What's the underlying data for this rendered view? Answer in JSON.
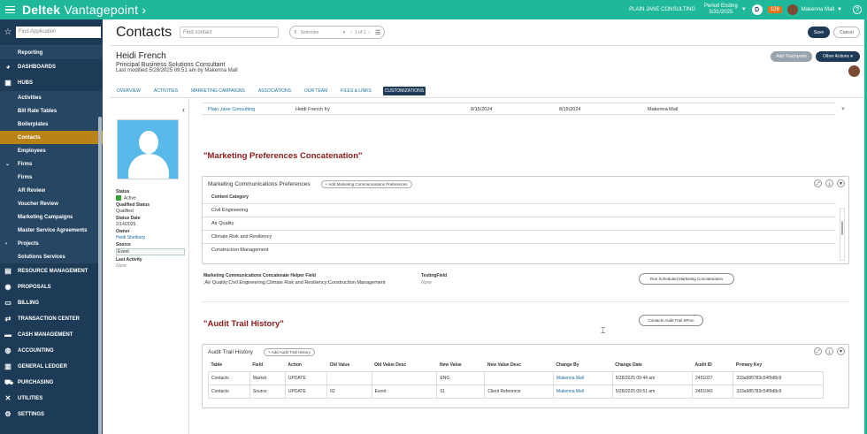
{
  "topbar": {
    "brand_main": "Deltek",
    "brand_sub": "Vantagepoint",
    "company": "PLAIN JANE CONSULTING",
    "period_label": "Period Ending",
    "period_date": "5/31/2025",
    "d_letter": "D",
    "notif_count": "128",
    "user": "Makenna Mall",
    "help": "?"
  },
  "sidebar": {
    "find_placeholder": "Find Application",
    "items": [
      {
        "label": "Reporting"
      },
      {
        "label": "DASHBOARDS"
      },
      {
        "label": "HUBS"
      },
      {
        "label": "Activities"
      },
      {
        "label": "Bill Rate Tables"
      },
      {
        "label": "Boilerplates"
      },
      {
        "label": "Contacts"
      },
      {
        "label": "Employees"
      },
      {
        "label": "Firms"
      },
      {
        "label": "Firms"
      },
      {
        "label": "AR Review"
      },
      {
        "label": "Voucher Review"
      },
      {
        "label": "Marketing Campaigns"
      },
      {
        "label": "Master Service Agreements"
      },
      {
        "label": "Projects"
      },
      {
        "label": "Solutions Services"
      },
      {
        "label": "RESOURCE MANAGEMENT"
      },
      {
        "label": "PROPOSALS"
      },
      {
        "label": "BILLING"
      },
      {
        "label": "TRANSACTION CENTER"
      },
      {
        "label": "CASH MANAGEMENT"
      },
      {
        "label": "ACCOUNTING"
      },
      {
        "label": "GENERAL LEDGER"
      },
      {
        "label": "PURCHASING"
      },
      {
        "label": "UTILITIES"
      },
      {
        "label": "SETTINGS"
      }
    ]
  },
  "header": {
    "title": "Contacts",
    "find_placeholder": "Find contact",
    "selection": "Selection",
    "pager": "1 of 1",
    "save": "Save",
    "cancel": "Cancel"
  },
  "record": {
    "name": "Heidi French",
    "role": "Principal Business Solutions Consultant",
    "modified": "Last modified 5/28/2025 09:51 am by Makenna Mall",
    "add_touchpoint": "Add Touchpoint",
    "other_actions": "Other Actions"
  },
  "tabs": [
    "OVERVIEW",
    "ACTIVITIES",
    "MARKETING CAMPAIGNS",
    "ASSOCIATIONS",
    "OUR TEAM",
    "FILES & LINKS",
    "CUSTOMIZATIONS"
  ],
  "profile": {
    "status_label": "Status",
    "status_value": "Active",
    "qualified_label": "Qualified Status",
    "qualified_value": "Qualified",
    "status_date_label": "Status Date",
    "status_date_value": "2/14/2025",
    "owner_label": "Owner",
    "owner_value": "Heidi Shelburg",
    "source_label": "Source",
    "source_value": "Event",
    "last_activity_label": "Last Activity",
    "last_activity_value": "None"
  },
  "toprow": {
    "firm": "Plain Jane Consulting",
    "contact": "Heidi French fry",
    "date1": "8/15/2024",
    "date2": "8/15/2024",
    "owner": "Makenna Mall"
  },
  "mkt": {
    "section_title": "\"Marketing Preferences Concatenation\"",
    "card_title": "Marketing Communications Preferences",
    "add_btn": "Add Marketing Communications Preferences",
    "col": "Content Category",
    "rows": [
      "Civil Engineering",
      "Air Quality",
      "Climate Risk and Resiliency",
      "Construction Management"
    ],
    "helper_label": "Marketing Communications Concatenate Helper Field",
    "helper_value": ";Air Quality;Civil Engineering;Climate Risk and Resiliency;Construction Management",
    "testing_label": "TestingField",
    "testing_value": "None",
    "run_btn": "Run Scheduled Marketing Concatenation"
  },
  "audit": {
    "section_title": "\"Audit Trail History\"",
    "sproc_btn": "Contacts Audit Trail SProc",
    "card_title": "Audit Trail History",
    "add_btn": "Add Audit Trail History",
    "columns": [
      "Table",
      "Field",
      "Action",
      "Old Value",
      "Old Value Desc",
      "New Value",
      "New Value Desc",
      "Change By",
      "Change Date",
      "Audit ID",
      "Primary Key"
    ],
    "rows": [
      [
        "Contacts",
        "Market",
        "UPDATE",
        "",
        "",
        "ENG",
        "",
        "Makenna Mall",
        "5/28/2025 09:44 am",
        "2451037",
        "333a985783c54f9d8c9"
      ],
      [
        "Contacts",
        "Source",
        "UPDATE",
        "02",
        "Event",
        "01",
        "Client Reference",
        "Makenna Mall",
        "5/28/2025 09:51 am",
        "2451040",
        "333a985783c54f9d8c9"
      ]
    ]
  }
}
